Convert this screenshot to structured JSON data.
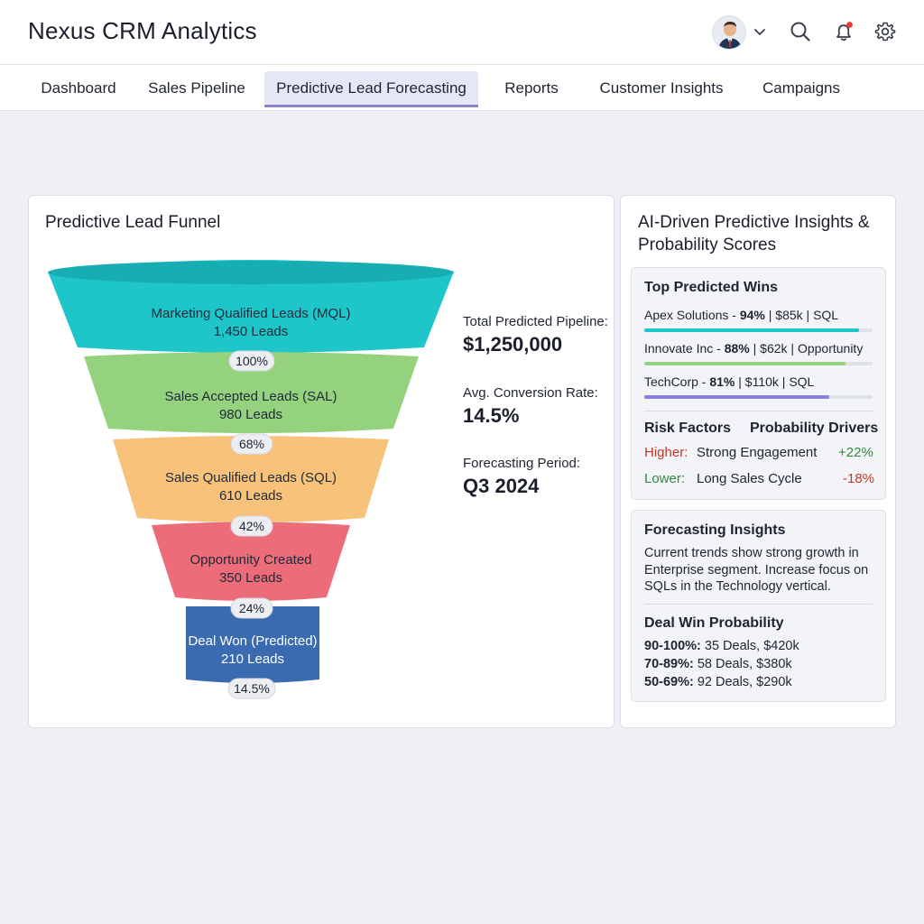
{
  "app": {
    "title": "Nexus CRM Analytics"
  },
  "header_icons": {
    "user_menu": "avatar",
    "chevron": "chevron-down-icon",
    "search": "search-icon",
    "notifications": "bell-icon",
    "settings": "gear-icon",
    "notification_dot_color": "#e53935"
  },
  "nav": {
    "tabs": [
      {
        "label": "Dashboard"
      },
      {
        "label": "Sales Pipeline"
      },
      {
        "label": "Predictive Lead Forecasting",
        "active": true
      },
      {
        "label": "Reports"
      },
      {
        "label": "Customer Insights"
      },
      {
        "label": "Campaigns"
      }
    ]
  },
  "funnel": {
    "title": "Predictive Lead Funnel",
    "stages": [
      {
        "name": "Marketing Qualified Leads (MQL)",
        "count": "1,450 Leads",
        "rate": "100%",
        "color": "#1ec6c9"
      },
      {
        "name": "Sales Accepted Leads (SAL)",
        "count": "980 Leads",
        "rate": "68%",
        "color": "#95d27e"
      },
      {
        "name": "Sales Qualified Leads (SQL)",
        "count": "610 Leads",
        "rate": "42%",
        "color": "#f8c27a"
      },
      {
        "name": "Opportunity Created",
        "count": "350 Leads",
        "rate": "24%",
        "color": "#ec6c7a"
      },
      {
        "name": "Deal Won (Predicted)",
        "count": "210 Leads",
        "rate": "14.5%",
        "color": "#3a6ab0"
      }
    ],
    "stats": [
      {
        "label": "Total Predicted Pipeline:",
        "value": "$1,250,000"
      },
      {
        "label": "Avg. Conversion Rate:",
        "value": "14.5%"
      },
      {
        "label": "Forecasting Period:",
        "value": "Q3 2024"
      }
    ]
  },
  "insights": {
    "title_line1": "AI-Driven Predictive Insights &",
    "title_line2": "Probability Scores",
    "top_wins": {
      "title": "Top Predicted Wins",
      "items": [
        {
          "company": "Apex Solutions - ",
          "prob": "94%",
          "rest": " | $85k | SQL",
          "progress": 0.94,
          "color": "#1ec6c9"
        },
        {
          "company": "Innovate Inc - ",
          "prob": "88%",
          "rest": " | $62k | Opportunity",
          "progress": 0.88,
          "color": "#95d27e"
        },
        {
          "company": "TechCorp - ",
          "prob": "81%",
          "rest": " | $110k | SQL",
          "progress": 0.81,
          "color": "#8a7fd6"
        }
      ]
    },
    "risk": {
      "title": "Risk Factors",
      "drivers_title": "Probability Drivers",
      "higher_label": "Higher:",
      "higher_text": "Strong Engagement",
      "higher_value": "+22%",
      "lower_label": "Lower:",
      "lower_text": "Long Sales Cycle",
      "lower_value": "-18%",
      "higher_color": "#c0392b",
      "lower_color": "#2e8b3a"
    },
    "forecasting": {
      "title": "Forecasting Insights",
      "text": "Current trends show strong growth in Enterprise segment. Increase focus on SQLs in the Technology vertical."
    },
    "deal_prob": {
      "title": "Deal Win Probability",
      "rows": [
        {
          "range": "90-100%:",
          "text": " 35 Deals, $420k"
        },
        {
          "range": "70-89%:",
          "text": " 58 Deals, $380k"
        },
        {
          "range": "50-69%:",
          "text": " 92 Deals, $290k"
        }
      ]
    }
  }
}
